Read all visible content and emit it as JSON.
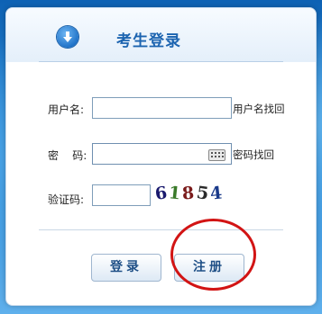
{
  "header": {
    "title": "考生登录",
    "icon": "download-arrow-icon"
  },
  "form": {
    "username_label": "用户名:",
    "username_value": "",
    "username_link": "用户名找回",
    "password_label": "密    码:",
    "password_value": "",
    "password_link": "密码找回",
    "captcha_label": "验证码:",
    "captcha_value": "",
    "captcha_text": [
      "6",
      "1",
      "8",
      "5",
      "4"
    ]
  },
  "buttons": {
    "login": "登录",
    "register": "注册"
  },
  "colors": {
    "accent": "#1c64b0",
    "highlight_circle": "#d21414",
    "background": "#1478c8"
  }
}
